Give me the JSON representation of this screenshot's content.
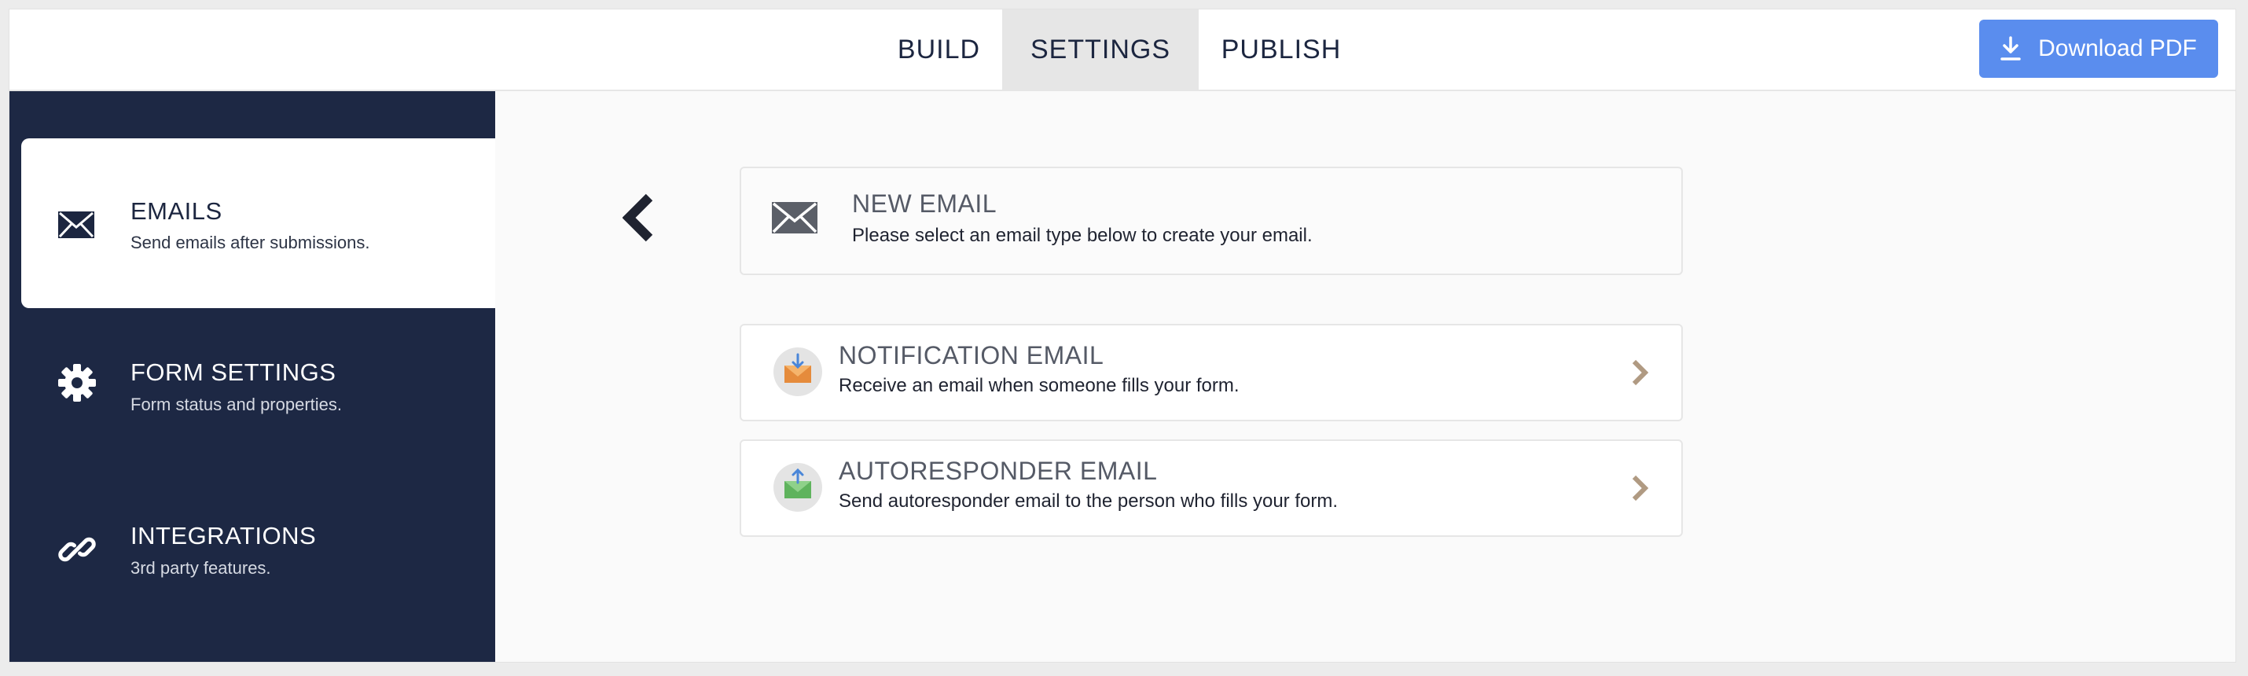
{
  "tabs": [
    {
      "label": "BUILD"
    },
    {
      "label": "SETTINGS",
      "active": true
    },
    {
      "label": "PUBLISH"
    }
  ],
  "download_button": {
    "label": "Download PDF",
    "icon": "download-icon"
  },
  "sidebar": {
    "items": [
      {
        "title": "EMAILS",
        "subtitle": "Send emails after submissions.",
        "icon": "envelope-icon",
        "active": true
      },
      {
        "title": "FORM SETTINGS",
        "subtitle": "Form status and properties.",
        "icon": "gear-icon"
      },
      {
        "title": "INTEGRATIONS",
        "subtitle": "3rd party features.",
        "icon": "link-icon"
      }
    ]
  },
  "main": {
    "header": {
      "title": "NEW EMAIL",
      "subtitle": "Please select an email type below to create your email.",
      "icon": "envelope-icon"
    },
    "options": [
      {
        "title": "NOTIFICATION EMAIL",
        "subtitle": "Receive an email when someone fills your form.",
        "icon": "notification-email-icon",
        "color": "#e58b3c"
      },
      {
        "title": "AUTORESPONDER EMAIL",
        "subtitle": "Send autoresponder email to the person who fills your form.",
        "icon": "autoresponder-email-icon",
        "color": "#5fb35d"
      }
    ]
  },
  "colors": {
    "sidebar_bg": "#1d2844",
    "accent_blue": "#5a8dee",
    "chevron": "#b09a82"
  }
}
